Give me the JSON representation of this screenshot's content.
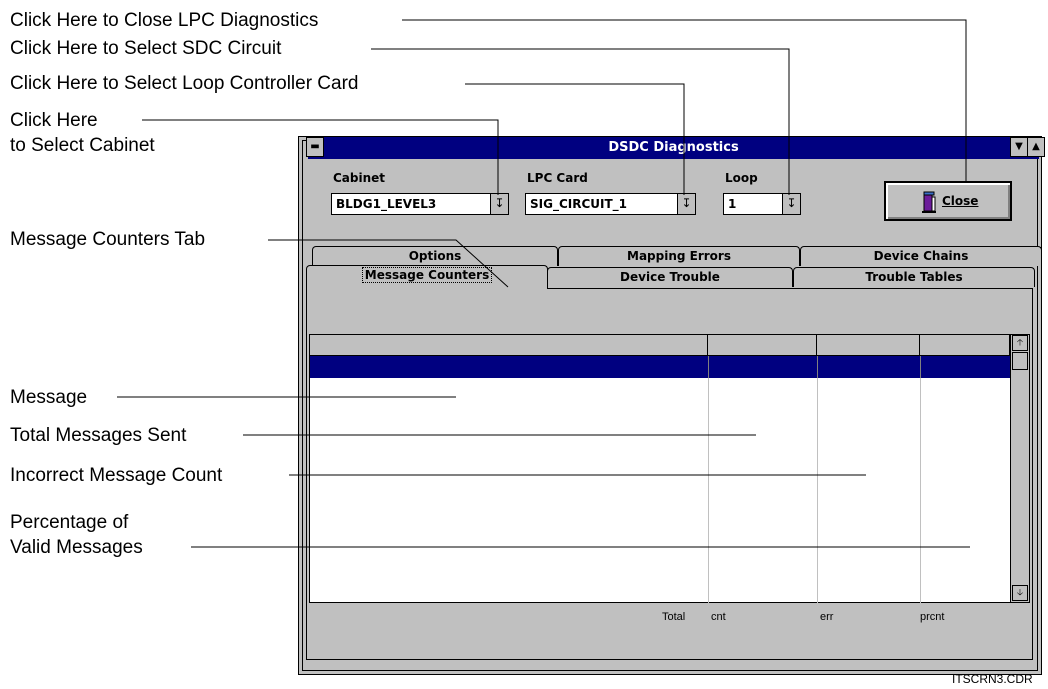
{
  "callouts": {
    "close": "Click Here to Close LPC Diagnostics",
    "circuit": "Click Here to Select SDC Circuit",
    "card": "Click Here to Select Loop Controller Card",
    "cabinet_l1": "Click Here",
    "cabinet_l2": "to Select Cabinet",
    "tab": "Message Counters Tab",
    "message": "Message",
    "total": "Total Messages Sent",
    "incorrect": "Incorrect Message Count",
    "pct_l1": "Percentage of",
    "pct_l2": "Valid Messages"
  },
  "window": {
    "title": "DSDC Diagnostics"
  },
  "fields": {
    "cabinet_label": "Cabinet",
    "cabinet_value": "BLDG1_LEVEL3",
    "lpc_label": "LPC Card",
    "lpc_value": "SIG_CIRCUIT_1",
    "loop_label": "Loop",
    "loop_value": "1"
  },
  "close_button": "Close",
  "tabs_back": [
    "Options",
    "Mapping Errors",
    "Device Chains"
  ],
  "tabs_front": [
    "Message Counters",
    "Device Trouble",
    "Trouble Tables"
  ],
  "active_tab": "Message Counters",
  "footer": {
    "total": "Total",
    "cnt": "cnt",
    "err": "err",
    "prcnt": "prcnt"
  },
  "filename": "ITSCRN3.CDR",
  "colors": {
    "titlebar": "#000080",
    "selection": "#000080",
    "face": "#c0c0c0"
  }
}
